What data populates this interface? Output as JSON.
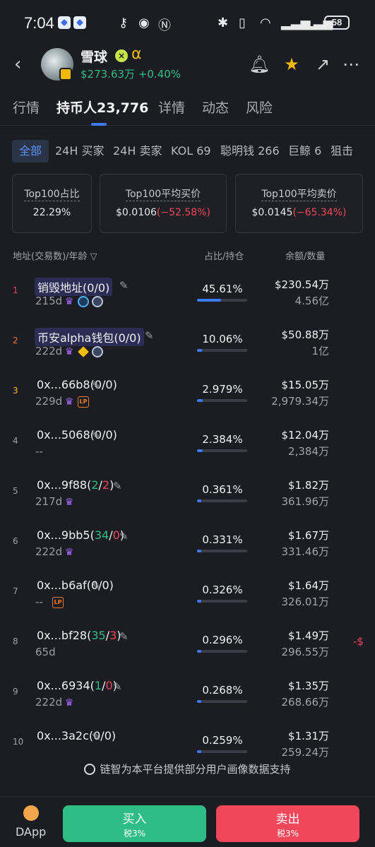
{
  "status_bar": {
    "time": "7:04",
    "battery": "58"
  },
  "header": {
    "coin_name": "雪球",
    "alpha_symbol": "α",
    "price": "$273.63万",
    "change": "+0.40%"
  },
  "tabs": [
    {
      "label": "行情"
    },
    {
      "label": "持币人23,776"
    },
    {
      "label": "详情"
    },
    {
      "label": "动态"
    },
    {
      "label": "风险"
    }
  ],
  "chips": [
    {
      "label": "全部"
    },
    {
      "label": "24H 买家"
    },
    {
      "label": "24H 卖家"
    },
    {
      "label": "KOL 69"
    },
    {
      "label": "聪明钱 266"
    },
    {
      "label": "巨鲸 6"
    },
    {
      "label": "狙击"
    }
  ],
  "cards": [
    {
      "label": "Top100占比",
      "value": "22.29%",
      "change": ""
    },
    {
      "label": "Top100平均买价",
      "value": "$0.0106",
      "change": "(−52.58%)"
    },
    {
      "label": "Top100平均卖价",
      "value": "$0.0145",
      "change": "(−65.34%)"
    }
  ],
  "table_header": {
    "address": "地址(交易数)/年龄",
    "share": "占比/持仓",
    "balance": "余额/数量"
  },
  "rows": [
    {
      "rank": "1",
      "addr": "销毁地址",
      "tx_a": "(0/0)",
      "tx_b": "",
      "tx_c": "",
      "age": "215d",
      "pct": "45.61%",
      "share": 0.4561,
      "usd": "$230.54万",
      "qty": "4.56亿",
      "edge": ""
    },
    {
      "rank": "2",
      "addr": "币安alpha钱包",
      "tx_a": "(0/0)",
      "tx_b": "",
      "tx_c": "",
      "age": "222d",
      "pct": "10.06%",
      "share": 0.1006,
      "usd": "$50.88万",
      "qty": "1亿",
      "edge": ""
    },
    {
      "rank": "3",
      "addr": "0x...66b8",
      "tx_a": "(0/0)",
      "tx_b": "",
      "tx_c": "",
      "age": "229d",
      "pct": "2.979%",
      "share": 0.0298,
      "usd": "$15.05万",
      "qty": "2,979.34万",
      "edge": ""
    },
    {
      "rank": "4",
      "addr": "0x...5068",
      "tx_a": "(0/0)",
      "tx_b": "",
      "tx_c": "",
      "age": "--",
      "pct": "2.384%",
      "share": 0.0238,
      "usd": "$12.04万",
      "qty": "2,384万",
      "edge": ""
    },
    {
      "rank": "5",
      "addr": "0x...9f88",
      "tx_a": "(",
      "tx_b": "2",
      "tx_c": "2",
      "age": "217d",
      "pct": "0.361%",
      "share": 0.00361,
      "usd": "$1.82万",
      "qty": "361.96万",
      "edge": ""
    },
    {
      "rank": "6",
      "addr": "0x...9bb5",
      "tx_a": "(",
      "tx_b": "34",
      "tx_c": "0",
      "age": "222d",
      "pct": "0.331%",
      "share": 0.00331,
      "usd": "$1.67万",
      "qty": "331.46万",
      "edge": ""
    },
    {
      "rank": "7",
      "addr": "0x...b6af",
      "tx_a": "(0/0)",
      "tx_b": "",
      "tx_c": "",
      "age": "--",
      "pct": "0.326%",
      "share": 0.00326,
      "usd": "$1.64万",
      "qty": "326.01万",
      "edge": ""
    },
    {
      "rank": "8",
      "addr": "0x...bf28",
      "tx_a": "(",
      "tx_b": "35",
      "tx_c": "3",
      "age": "65d",
      "pct": "0.296%",
      "share": 0.00296,
      "usd": "$1.49万",
      "qty": "296.55万",
      "edge": "-$"
    },
    {
      "rank": "9",
      "addr": "0x...6934",
      "tx_a": "(",
      "tx_b": "1",
      "tx_c": "0",
      "age": "222d",
      "pct": "0.268%",
      "share": 0.00268,
      "usd": "$1.35万",
      "qty": "268.66万",
      "edge": ""
    },
    {
      "rank": "10",
      "addr": "0x...3a2c",
      "tx_a": "(0/0)",
      "tx_b": "",
      "tx_c": "",
      "age": "",
      "pct": "0.259%",
      "share": 0.00259,
      "usd": "$1.31万",
      "qty": "259.24万",
      "edge": ""
    }
  ],
  "footer_note": "链智为本平台提供部分用户画像数据支持",
  "bottom": {
    "dapp": "DApp",
    "buy": "买入",
    "buy_tax": "税3%",
    "sell": "卖出",
    "sell_tax": "税3%"
  },
  "colors": {
    "accent": "#3d7bf5",
    "buy": "#2ebd85",
    "sell": "#f0475a",
    "background": "#1b1d22"
  },
  "icons": [
    "back-icon",
    "bell-icon",
    "star-icon",
    "share-icon",
    "more-icon",
    "edit-icon",
    "crown-icon",
    "lp-icon",
    "filter-icon"
  ]
}
